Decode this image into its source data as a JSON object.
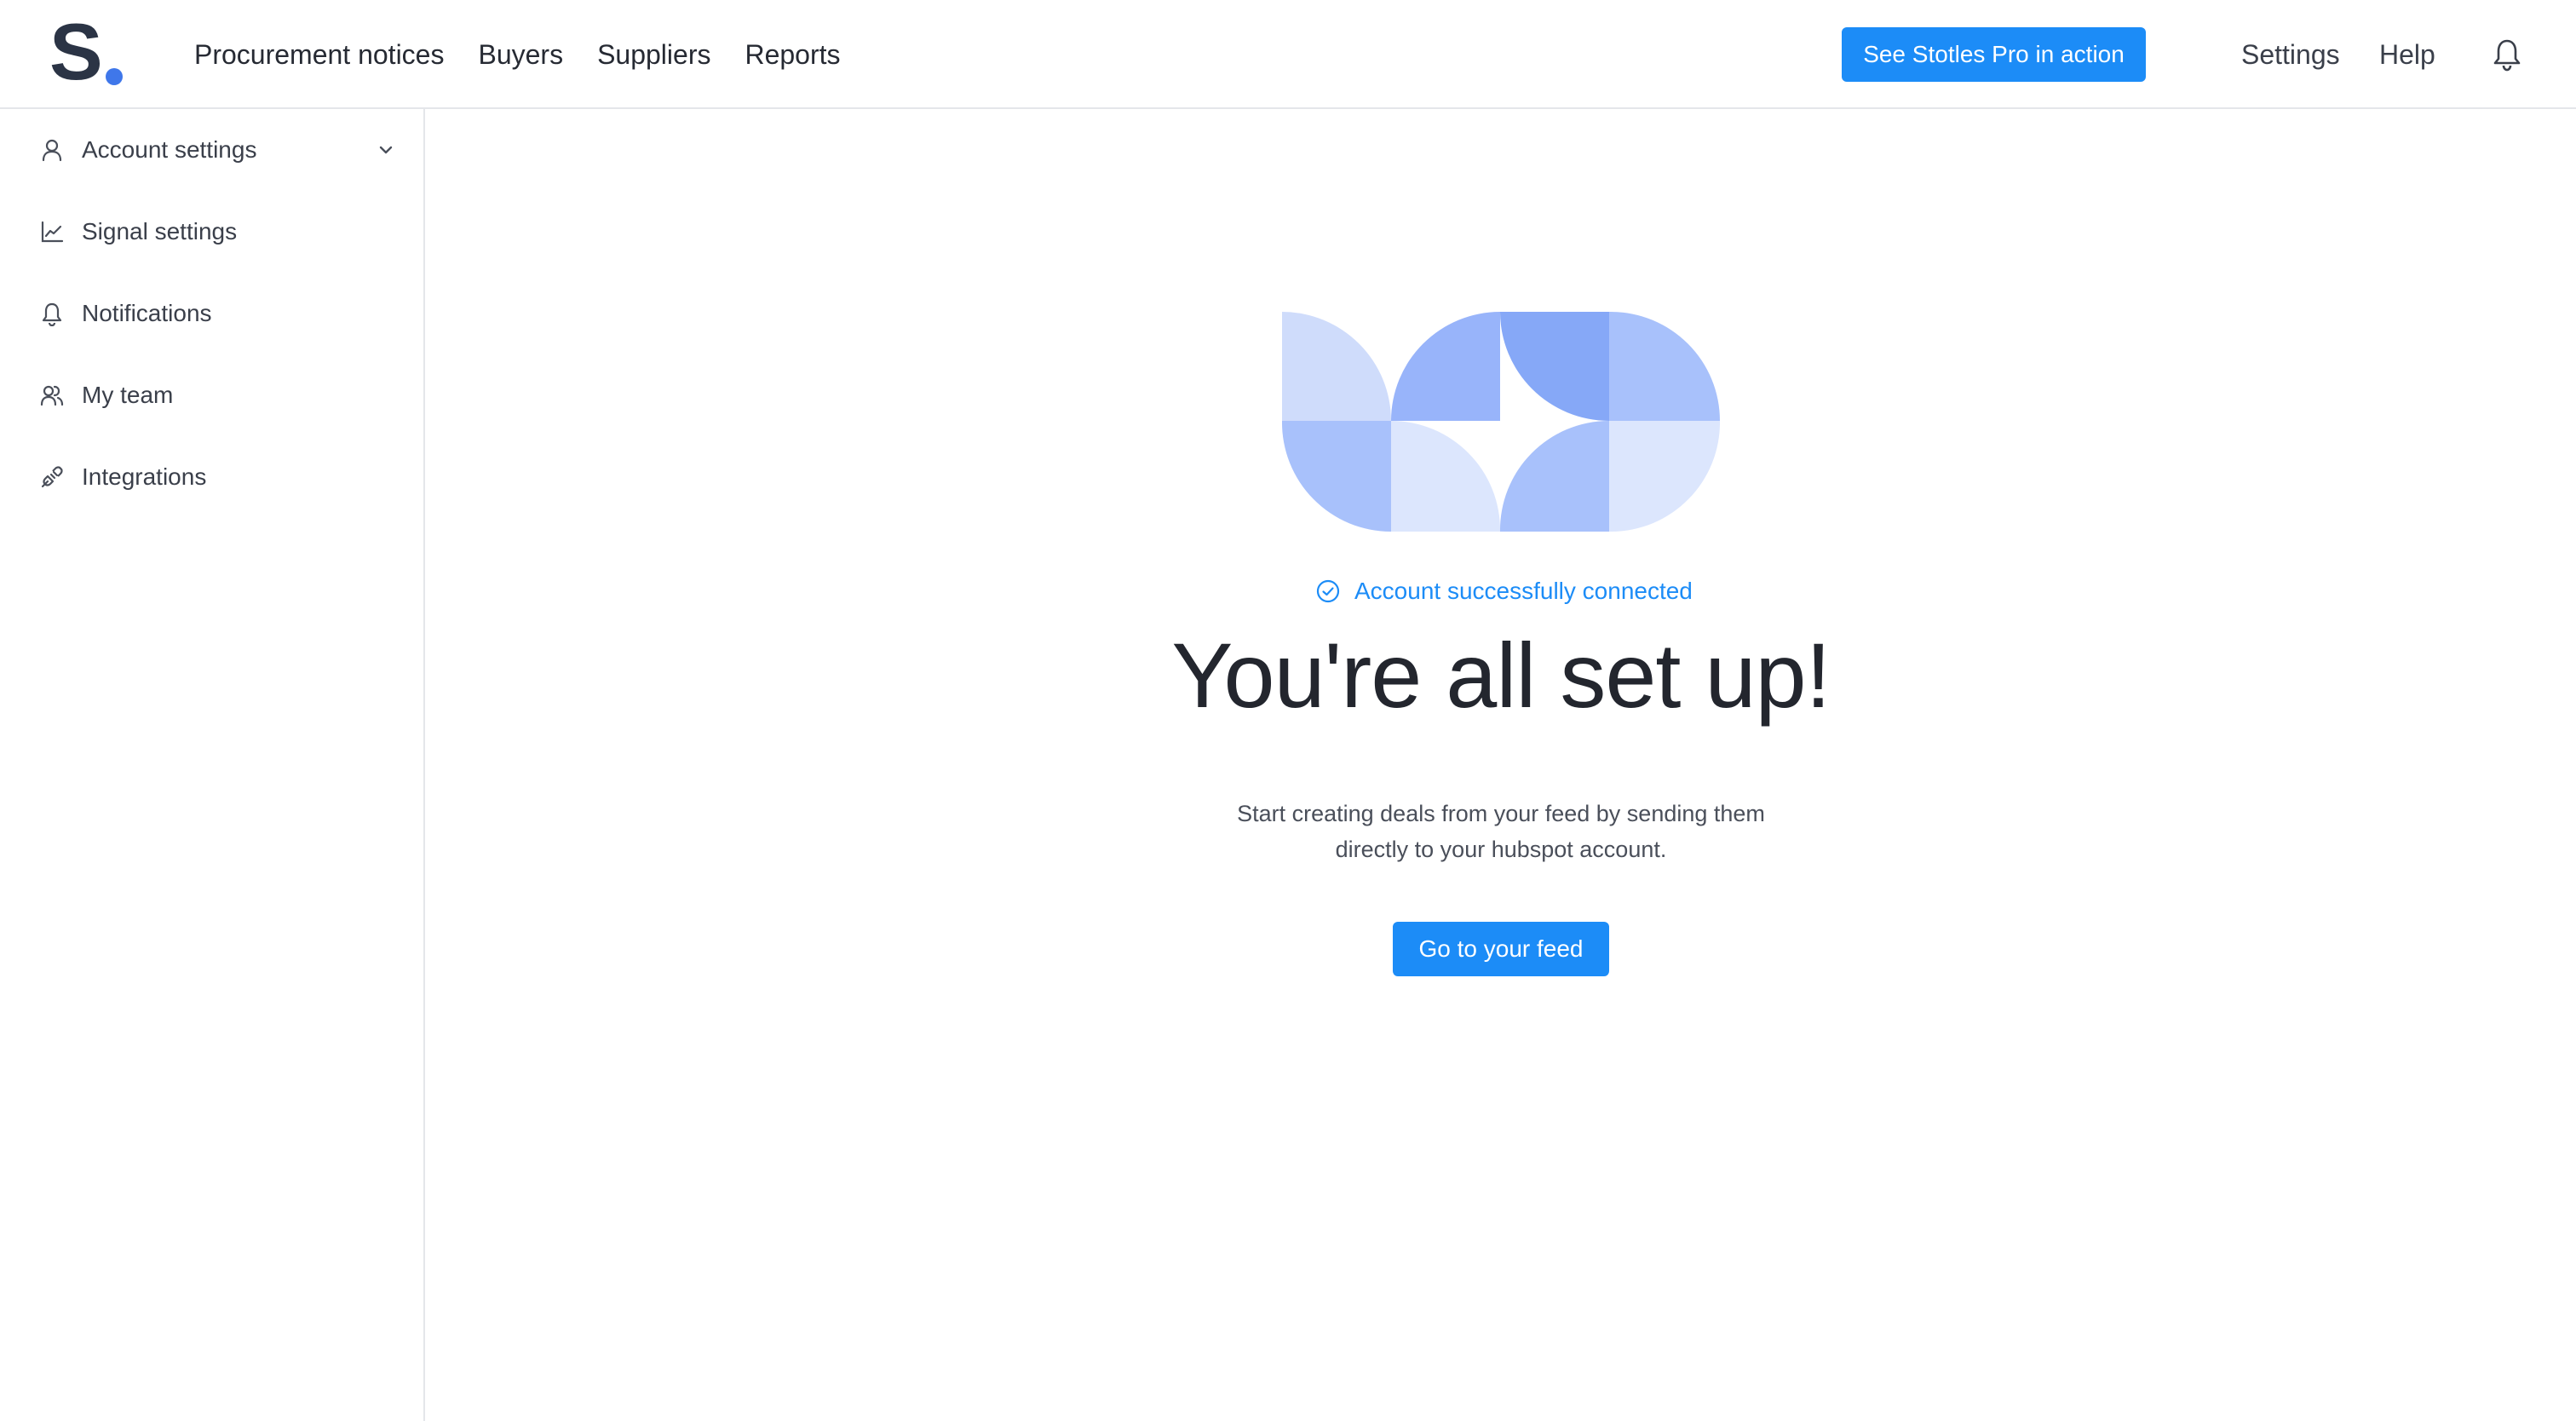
{
  "brand": {
    "logo_letter": "S",
    "accent": "#3f77ea",
    "primary": "#1c8cf7"
  },
  "nav": {
    "items": [
      {
        "label": "Procurement notices"
      },
      {
        "label": "Buyers"
      },
      {
        "label": "Suppliers"
      },
      {
        "label": "Reports"
      }
    ],
    "cta_label": "See Stotles Pro in action",
    "settings_label": "Settings",
    "help_label": "Help",
    "notifications_icon": "bell-icon"
  },
  "sidebar": {
    "items": [
      {
        "label": "Account settings",
        "icon": "user-icon",
        "expandable": true
      },
      {
        "label": "Signal settings",
        "icon": "chart-line-icon"
      },
      {
        "label": "Notifications",
        "icon": "bell-icon"
      },
      {
        "label": "My team",
        "icon": "team-icon"
      },
      {
        "label": "Integrations",
        "icon": "plug-icon"
      }
    ]
  },
  "main": {
    "status_text": "Account successfully connected",
    "headline": "You're all set up!",
    "subtext_line1": "Start creating deals from your feed by sending them",
    "subtext_line2": "directly to your hubspot account.",
    "cta_label": "Go to your feed"
  },
  "illustration": {
    "colors": {
      "light": "#cfdcfb",
      "mid": "#a8c1fb",
      "deep": "#8aaaf7",
      "pale": "#dce6fd"
    }
  }
}
